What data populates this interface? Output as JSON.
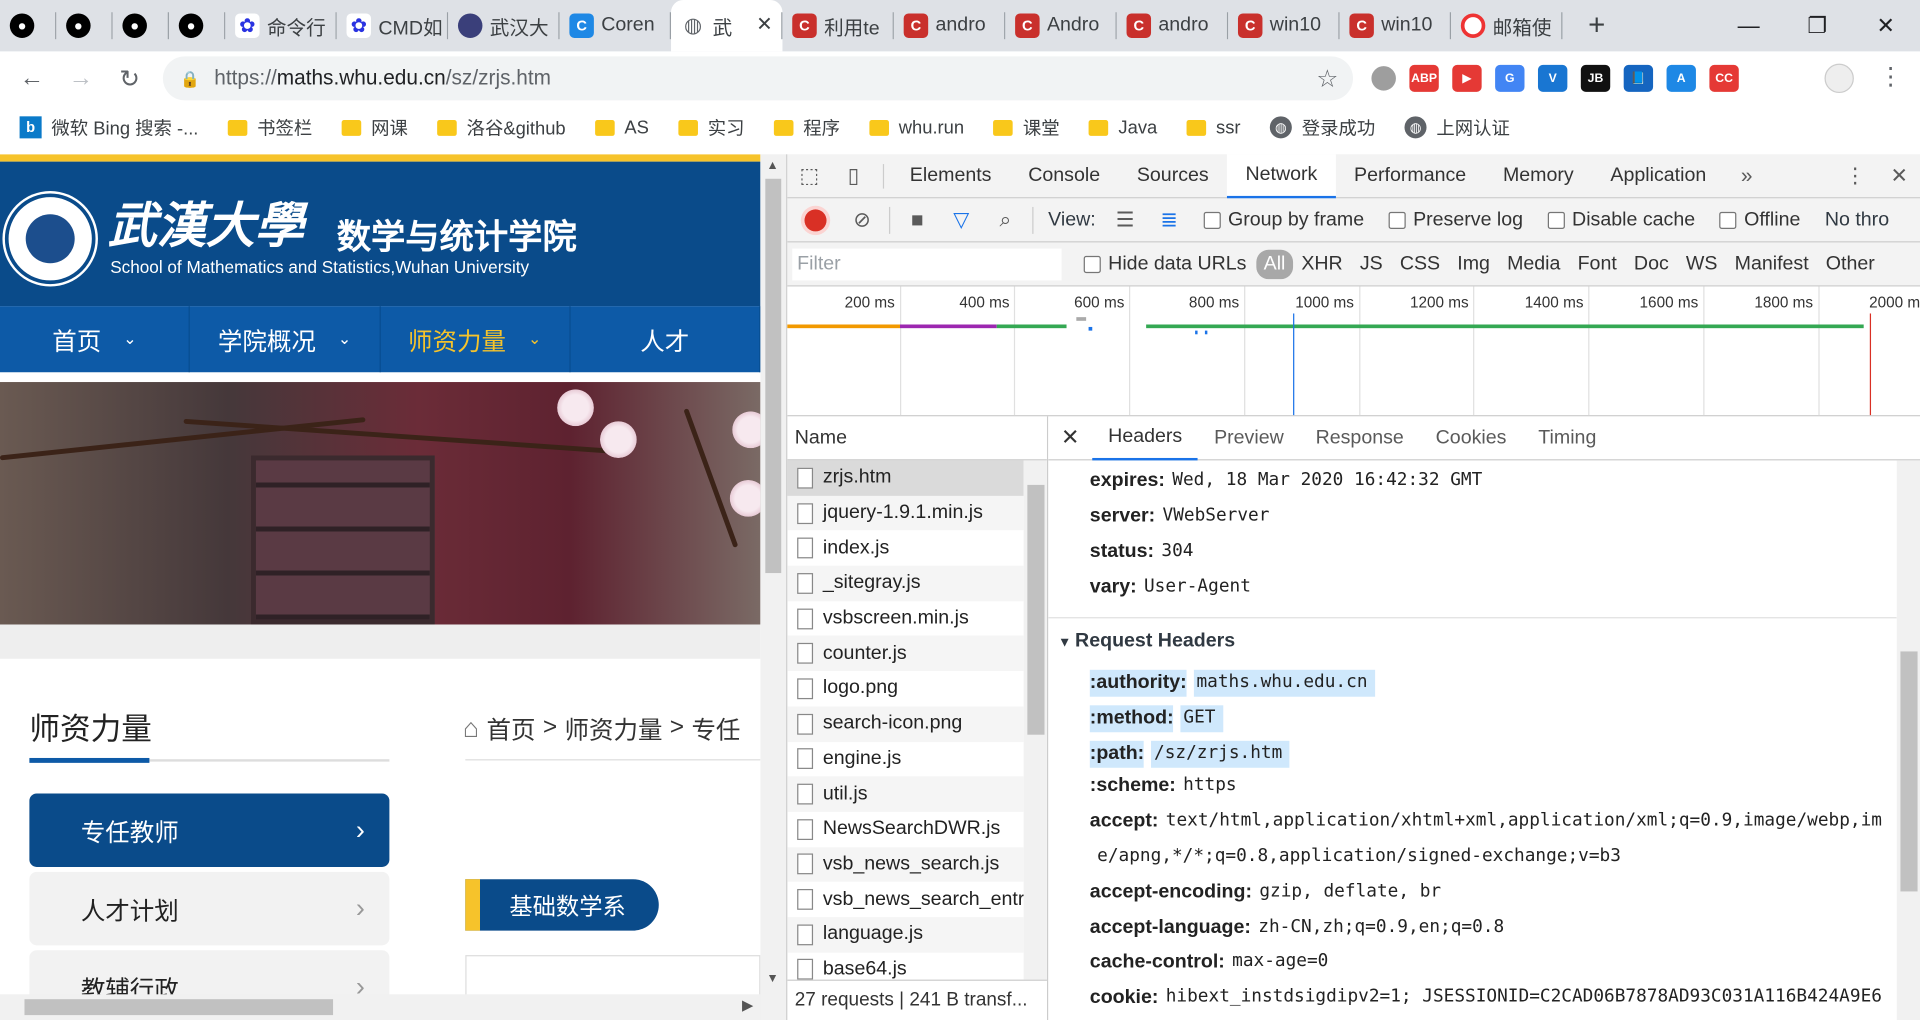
{
  "tabs": [
    {
      "icon": "github",
      "label": ""
    },
    {
      "icon": "github",
      "label": ""
    },
    {
      "icon": "github",
      "label": ""
    },
    {
      "icon": "github",
      "label": ""
    },
    {
      "icon": "baidu",
      "label": "命令行"
    },
    {
      "icon": "baidu",
      "label": "CMD如"
    },
    {
      "icon": "whu",
      "label": "武汉大"
    },
    {
      "icon": "coren",
      "label": "Coren"
    },
    {
      "icon": "globe",
      "label": "武"
    },
    {
      "icon": "csdn",
      "label": "利用te"
    },
    {
      "icon": "csdn",
      "label": "andro"
    },
    {
      "icon": "csdn",
      "label": "Andro"
    },
    {
      "icon": "csdn",
      "label": "andro"
    },
    {
      "icon": "csdn",
      "label": "win10"
    },
    {
      "icon": "csdn",
      "label": "win10"
    },
    {
      "icon": "mail",
      "label": "邮箱使"
    }
  ],
  "address": {
    "scheme": "https://",
    "host": "maths.whu.edu.cn",
    "path": "/sz/zrjs.htm"
  },
  "extensions": [
    {
      "name": "circle-ext",
      "color": "#9e9e9e",
      "text": ""
    },
    {
      "name": "adblock-ext",
      "color": "#e53935",
      "text": "ABP"
    },
    {
      "name": "youtube-ext",
      "color": "#e53935",
      "text": "▶"
    },
    {
      "name": "translate-ext",
      "color": "#4285f4",
      "text": "G"
    },
    {
      "name": "v-ext",
      "color": "#1976d2",
      "text": "V"
    },
    {
      "name": "jb-ext",
      "color": "#111111",
      "text": "JB"
    },
    {
      "name": "book-ext",
      "color": "#1565c0",
      "text": "📘"
    },
    {
      "name": "lang-ext",
      "color": "#1e88e5",
      "text": "A"
    },
    {
      "name": "cc-ext",
      "color": "#e53935",
      "text": "CC"
    }
  ],
  "bookmarks": [
    {
      "type": "bing",
      "label": "微软 Bing 搜索 -..."
    },
    {
      "type": "folder",
      "label": "书签栏"
    },
    {
      "type": "folder",
      "label": "网课"
    },
    {
      "type": "folder",
      "label": "洛谷&github"
    },
    {
      "type": "folder",
      "label": "AS"
    },
    {
      "type": "folder",
      "label": "实习"
    },
    {
      "type": "folder",
      "label": "程序"
    },
    {
      "type": "folder",
      "label": "whu.run"
    },
    {
      "type": "folder",
      "label": "课堂"
    },
    {
      "type": "folder",
      "label": "Java"
    },
    {
      "type": "folder",
      "label": "ssr"
    },
    {
      "type": "globe",
      "label": "登录成功"
    },
    {
      "type": "globe",
      "label": "上网认证"
    }
  ],
  "site": {
    "calligraphy": "武漢大學",
    "college_title": "数学与统计学院",
    "college_en": "School of Mathematics and Statistics,Wuhan University",
    "nav": [
      "首页",
      "学院概况",
      "师资力量",
      "人才"
    ],
    "side_title": "师资力量",
    "side_items": [
      "专任教师",
      "人才计划",
      "教辅行政"
    ],
    "breadcrumb": [
      "首页",
      ">",
      "师资力量",
      ">",
      "专任"
    ],
    "dept_button": "基础数学系"
  },
  "devtools": {
    "tabs": [
      "Elements",
      "Console",
      "Sources",
      "Network",
      "Performance",
      "Memory",
      "Application"
    ],
    "active_tab": "Network",
    "toolbar": {
      "view_label": "View:",
      "group_by_frame": "Group by frame",
      "preserve_log": "Preserve log",
      "disable_cache": "Disable cache",
      "offline": "Offline",
      "throttle": "No thro"
    },
    "filter_placeholder": "Filter",
    "hide_data_urls": "Hide data URLs",
    "types": [
      "All",
      "XHR",
      "JS",
      "CSS",
      "Img",
      "Media",
      "Font",
      "Doc",
      "WS",
      "Manifest",
      "Other"
    ],
    "timeline_labels": [
      "200 ms",
      "400 ms",
      "600 ms",
      "800 ms",
      "1000 ms",
      "1200 ms",
      "1400 ms",
      "1600 ms",
      "1800 ms",
      "2000 ms"
    ],
    "name_header": "Name",
    "requests": [
      "zrjs.htm",
      "jquery-1.9.1.min.js",
      "index.js",
      "_sitegray.js",
      "vsbscreen.min.js",
      "counter.js",
      "logo.png",
      "search-icon.png",
      "engine.js",
      "util.js",
      "NewsSearchDWR.js",
      "vsb_news_search.js",
      "vsb_news_search_entry",
      "language.js",
      "base64.js"
    ],
    "status_bar": "27 requests | 241 B transf...",
    "detail_tabs": [
      "Headers",
      "Preview",
      "Response",
      "Cookies",
      "Timing"
    ],
    "response_headers": [
      {
        "key": "expires:",
        "value": "Wed, 18 Mar 2020 16:42:32 GMT"
      },
      {
        "key": "server:",
        "value": "VWebServer"
      },
      {
        "key": "status:",
        "value": "304"
      },
      {
        "key": "vary:",
        "value": "User-Agent"
      }
    ],
    "request_section": "Request Headers",
    "request_headers": [
      {
        "key": ":authority:",
        "value": "maths.whu.edu.cn",
        "hl": true
      },
      {
        "key": ":method:",
        "value": "GET",
        "hl": true
      },
      {
        "key": ":path:",
        "value": "/sz/zrjs.htm",
        "hl": true
      },
      {
        "key": ":scheme:",
        "value": "https",
        "hl": false
      },
      {
        "key": "accept:",
        "value": "text/html,application/xhtml+xml,application/xml;q=0.9,image/webp,im",
        "hl": false
      },
      {
        "key": "",
        "value": "e/apng,*/*;q=0.8,application/signed-exchange;v=b3",
        "hl": false
      },
      {
        "key": "accept-encoding:",
        "value": "gzip, deflate, br",
        "hl": false
      },
      {
        "key": "accept-language:",
        "value": "zh-CN,zh;q=0.9,en;q=0.8",
        "hl": false
      },
      {
        "key": "cache-control:",
        "value": "max-age=0",
        "hl": false
      },
      {
        "key": "cookie:",
        "value": "hibext_instdsigdipv2=1; JSESSIONID=C2CAD06B7878AD93C031A116B424A9E6",
        "hl": false
      }
    ]
  }
}
